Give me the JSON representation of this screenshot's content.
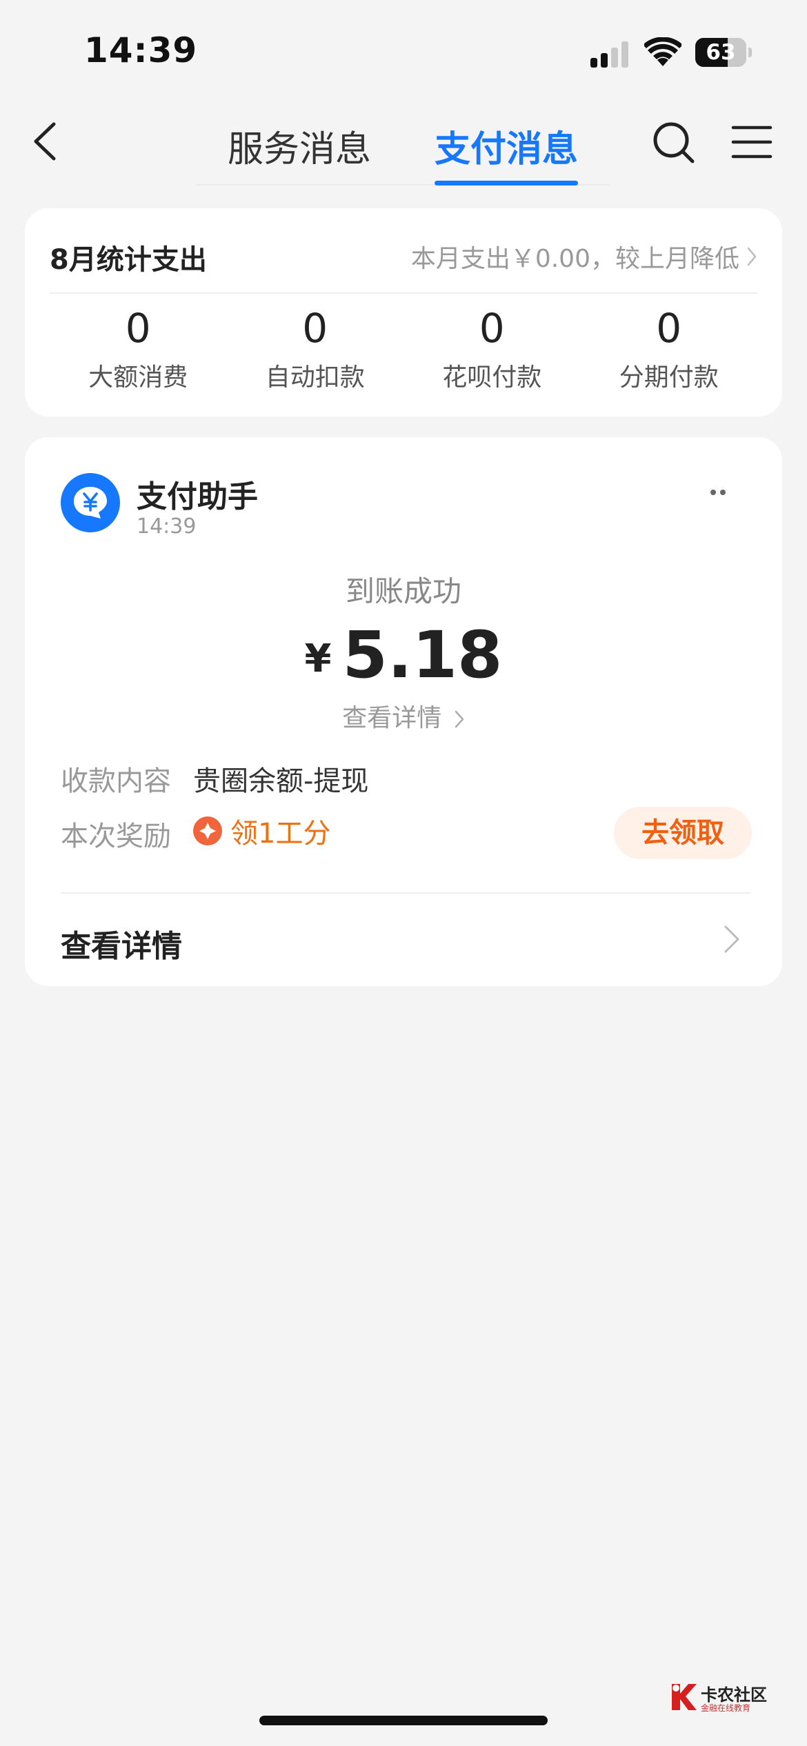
{
  "status_bar": {
    "time": "14:39",
    "battery_level": "63",
    "battery_fraction": 0.63
  },
  "nav": {
    "tabs": [
      {
        "label": "服务消息",
        "active": false
      },
      {
        "label": "支付消息",
        "active": true
      }
    ],
    "accent_color": "#1677ff"
  },
  "stats": {
    "title": "8月统计支出",
    "summary": "本月支出￥0.00，较上月降低",
    "items": [
      {
        "value": "0",
        "label": "大额消费"
      },
      {
        "value": "0",
        "label": "自动扣款"
      },
      {
        "value": "0",
        "label": "花呗付款"
      },
      {
        "value": "0",
        "label": "分期付款"
      }
    ]
  },
  "message": {
    "sender": "支付助手",
    "time": "14:39",
    "avatar_icon": "yen-chat-icon",
    "status": "到账成功",
    "currency_symbol": "¥",
    "amount": "5.18",
    "detail_link": "查看详情",
    "content_label": "收款内容",
    "content_value": "贵圈余额-提现",
    "reward_label": "本次奖励",
    "reward_value": "领1工分",
    "claim_button": "去领取",
    "footer_link": "查看详情"
  },
  "watermark": {
    "text": "卡农社区",
    "subtext": "金融在线教育"
  }
}
